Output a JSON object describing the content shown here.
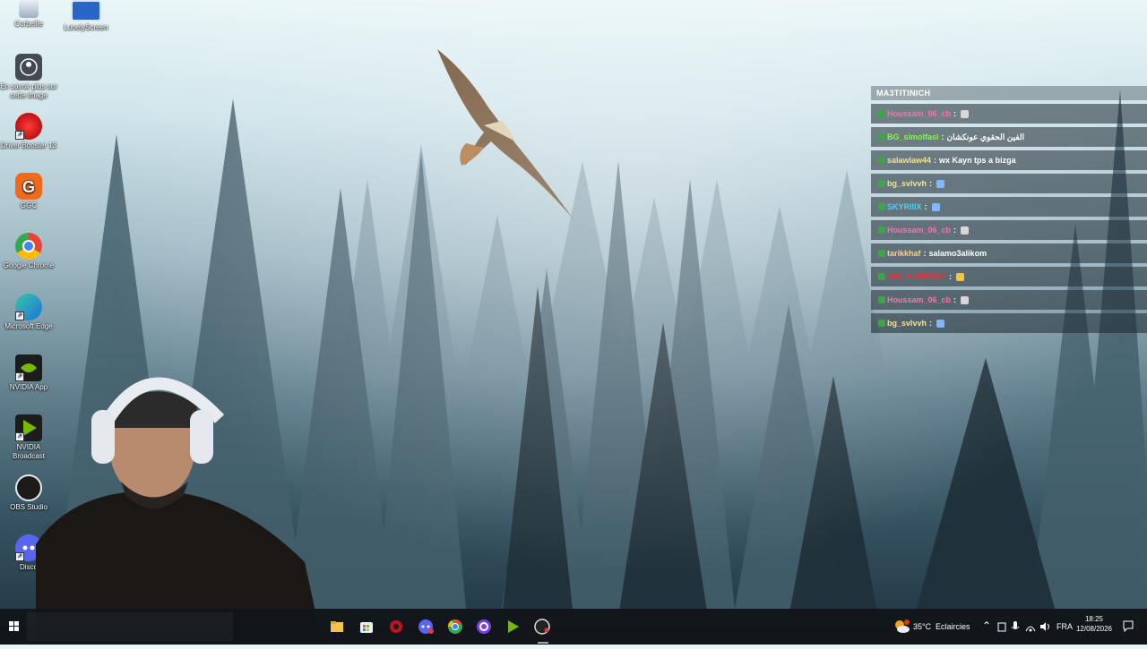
{
  "desktop": {
    "icons": [
      {
        "label": "Corbeille"
      },
      {
        "label": "LonelyScreen"
      },
      {
        "label": "En savoir plus sur cette image"
      },
      {
        "label": "Driver Booster 13"
      },
      {
        "label": "GGC"
      },
      {
        "label": "Google Chrome"
      },
      {
        "label": "Microsoft Edge"
      },
      {
        "label": "NVIDIA App"
      },
      {
        "label": "NVIDIA Broadcast"
      },
      {
        "label": "OBS Studio"
      },
      {
        "label": "Disco"
      }
    ]
  },
  "chat": {
    "title": "MA3TITINICH",
    "messages": [
      {
        "user": "Houssam_06_cb",
        "color": "#ff6fb0",
        "text": "",
        "emote": "gem-icon"
      },
      {
        "user": "BG_simolfasi",
        "color": "#7cff3a",
        "text": "الفين الحقوي عونكشان",
        "emote": ""
      },
      {
        "user": "salawlaw44",
        "color": "#f2e28a",
        "text": "wx Kayn tps a bizga",
        "emote": ""
      },
      {
        "user": "bg_svlvvh",
        "color": "#f4e48e",
        "text": "",
        "emote": "hammer-icon"
      },
      {
        "user": "SKYRIIIX",
        "color": "#46d2ff",
        "text": "",
        "emote": "hammer-icon"
      },
      {
        "user": "Houssam_06_cb",
        "color": "#ff6fb0",
        "text": "",
        "emote": "gem-icon"
      },
      {
        "user": "tarikkhaf",
        "color": "#ffd27a",
        "text": "salamo3alikom",
        "emote": ""
      },
      {
        "user": "IMG_NDREDAZ",
        "color": "#ff2b2b",
        "text": "",
        "emote": "clap-icon"
      },
      {
        "user": "Houssam_06_cb",
        "color": "#ff6fb0",
        "text": "",
        "emote": "gem-icon"
      },
      {
        "user": "bg_svlvvh",
        "color": "#f4e48e",
        "text": "",
        "emote": "hammer-icon"
      }
    ]
  },
  "taskbar": {
    "weather_temp": "35°C",
    "weather_desc": "Eclaircies",
    "language": "FRA",
    "time": "18:25",
    "date": "12/08/2026",
    "apps": [
      "windows-icon",
      "file-explorer-icon",
      "store-icon",
      "driver-booster-icon",
      "discord-icon",
      "chrome-icon",
      "obs-like-icon",
      "nvidia-broadcast-icon",
      "obs-icon"
    ]
  }
}
